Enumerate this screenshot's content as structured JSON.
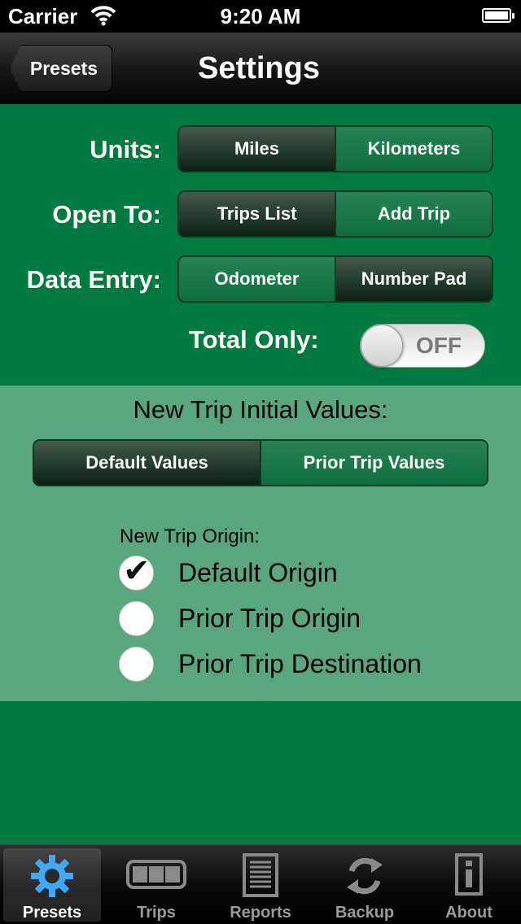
{
  "status_bar": {
    "carrier": "Carrier",
    "time": "9:20 AM"
  },
  "nav": {
    "back_label": "Presets",
    "title": "Settings"
  },
  "settings": {
    "units": {
      "label": "Units:",
      "options": [
        "Miles",
        "Kilometers"
      ],
      "selected": "Miles"
    },
    "open_to": {
      "label": "Open To:",
      "options": [
        "Trips List",
        "Add Trip"
      ],
      "selected": "Trips List"
    },
    "data_entry": {
      "label": "Data Entry:",
      "options": [
        "Odometer",
        "Number Pad"
      ],
      "selected": "Number Pad"
    },
    "total_only": {
      "label": "Total Only:",
      "state": "OFF"
    }
  },
  "initial_values": {
    "title": "New Trip Initial Values:",
    "options": [
      "Default Values",
      "Prior Trip Values"
    ],
    "selected": "Default Values"
  },
  "origin": {
    "label": "New Trip Origin:",
    "options": [
      {
        "label": "Default Origin",
        "checked": true
      },
      {
        "label": "Prior Trip Origin",
        "checked": false
      },
      {
        "label": "Prior Trip Destination",
        "checked": false
      }
    ]
  },
  "tabs": [
    {
      "label": "Presets",
      "icon": "gear-icon",
      "active": true
    },
    {
      "label": "Trips",
      "icon": "trips-icon",
      "active": false
    },
    {
      "label": "Reports",
      "icon": "reports-icon",
      "active": false
    },
    {
      "label": "Backup",
      "icon": "sync-icon",
      "active": false
    },
    {
      "label": "About",
      "icon": "info-icon",
      "active": false
    }
  ],
  "colors": {
    "green": "#007a41",
    "light_green": "#59a67f",
    "tab_active": "#3fa9f5"
  }
}
